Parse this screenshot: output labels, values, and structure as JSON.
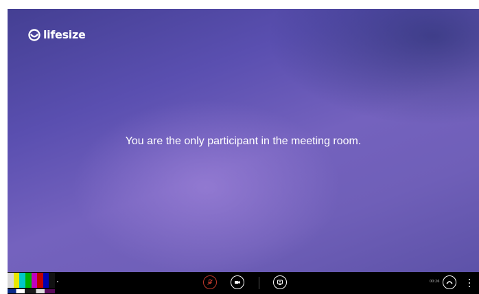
{
  "brand": {
    "name": "lifesize",
    "icon": "lifesize-logo-icon"
  },
  "stage": {
    "message": "You are the only participant in the meeting room.",
    "colors": {
      "top": "#443f93",
      "mid": "#7462be",
      "glow": "#aa8ce1"
    }
  },
  "self_view": {
    "bar_colors": [
      "#d8d8d8",
      "#e8e800",
      "#00c8c8",
      "#00b000",
      "#c000c0",
      "#c00000",
      "#0000b0",
      "#111111"
    ]
  },
  "toolbar": {
    "background": "#000000",
    "mute_icon": "microphone-muted-icon",
    "mute_color": "#c0392b",
    "camera_icon": "video-camera-icon",
    "share_icon": "screen-share-icon",
    "timer": "00:26",
    "hangup_icon": "hang-up-icon",
    "more_icon": "more-vertical-icon"
  }
}
